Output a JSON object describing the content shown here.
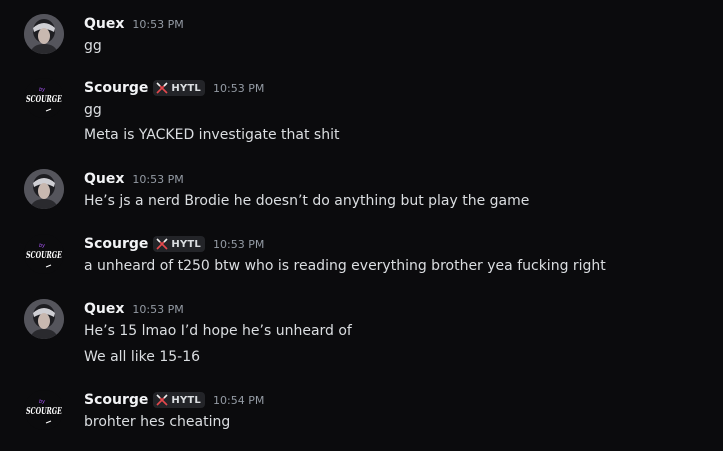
{
  "messages": [
    {
      "author": "Quex",
      "tag": "",
      "time": "10:53 PM",
      "lines": [
        "gg"
      ]
    },
    {
      "author": "Scourge",
      "tag": "HYTL",
      "time": "10:53 PM",
      "lines": [
        "gg",
        "Meta is YACKED investigate that shit"
      ]
    },
    {
      "author": "Quex",
      "tag": "",
      "time": "10:53 PM",
      "lines": [
        "He’s js a nerd Brodie he doesn’t do anything but play the game"
      ]
    },
    {
      "author": "Scourge",
      "tag": "HYTL",
      "time": "10:53 PM",
      "lines": [
        "a unheard of t250 btw who is reading everything brother yea fucking right"
      ]
    },
    {
      "author": "Quex",
      "tag": "",
      "time": "10:53 PM",
      "lines": [
        "He’s 15 lmao I’d hope he’s unheard of",
        "We all like 15-16"
      ]
    },
    {
      "author": "Scourge",
      "tag": "HYTL",
      "time": "10:54 PM",
      "lines": [
        "brohter hes cheating"
      ]
    }
  ],
  "avatars": {
    "scourge_logo_text": "SCOURGE",
    "scourge_logo_small": "by"
  },
  "colors": {
    "background": "#0b0b0d",
    "username": "#f2f3f5",
    "message_text": "#dbdee1",
    "timestamp": "#949ba4",
    "tag_bg": "#232428",
    "tag_icon": "#e5484d",
    "logo_accent": "#a855f7"
  },
  "icons": {
    "tag_icon": "crossed-swords-icon"
  }
}
